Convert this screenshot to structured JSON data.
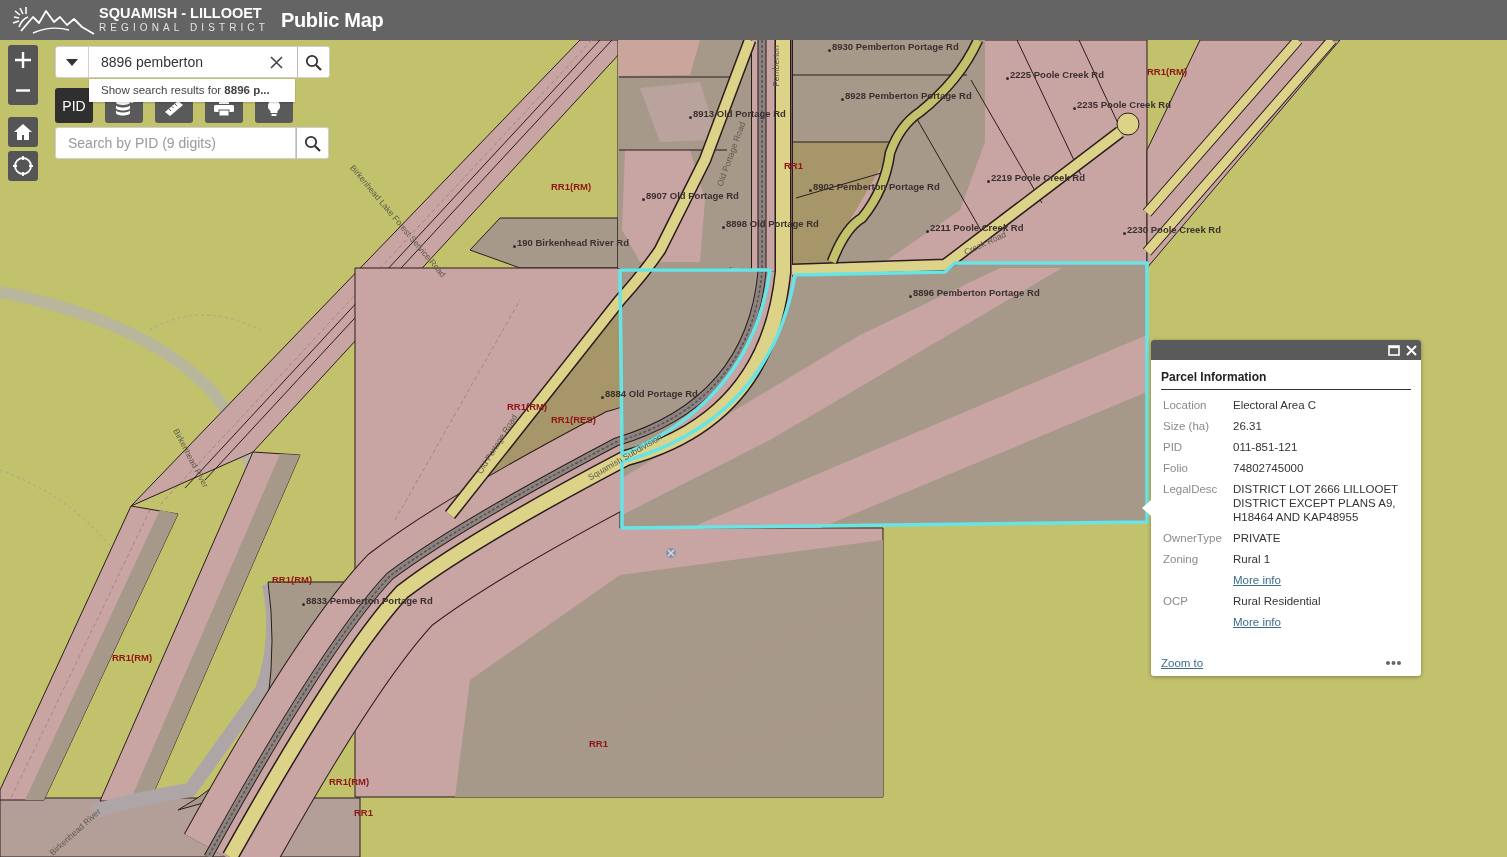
{
  "header": {
    "logo_line_1": "SQUAMISH - LILLOOET",
    "logo_line_2": "REGIONAL DISTRICT",
    "title": "Public Map"
  },
  "search": {
    "value": "8896 pemberton",
    "suggestion": "Show search results for **8896 p...**"
  },
  "toolbar": [
    {
      "kind": "text",
      "label": "PID",
      "selected": true
    },
    {
      "kind": "layers",
      "selected": false
    },
    {
      "kind": "measure",
      "selected": false
    },
    {
      "kind": "print",
      "selected": false
    },
    {
      "kind": "bulb",
      "selected": false
    }
  ],
  "pid_search": {
    "placeholder": "Search by PID (9 digits)"
  },
  "map": {
    "address_labels": [
      "8930 Pemberton Portage Rd",
      "2225 Poole Creek Rd",
      "8928 Pemberton Portage Rd",
      "2235 Poole Creek Rd",
      "8913 Old Portage Rd",
      "2219 Poole Creek Rd",
      "8902 Pemberton Portage Rd",
      "8907 Old Portage Rd",
      "8898 Old Portage Rd",
      "2211 Poole Creek Rd",
      "2230 Poole Creek Rd",
      "190 Birkenhead River Rd",
      "8896 Pemberton Portage Rd",
      "8884 Old Portage Rd",
      "8833 Pemberton Portage Rd"
    ],
    "zoning_labels": [
      "RR1(RM)",
      "RR1",
      "RR1(RM)",
      "RR1(RM)",
      "RR1(RES)",
      "RR1(RM)",
      "RR1(RM)",
      "RR1",
      "RR1(RM)",
      "RR1"
    ],
    "road_labels": [
      "Pemberton",
      "Old Portage Road",
      "Birkenhead Lake Forest Service Road",
      "Old Portage Road",
      "Squamish Subdivision",
      "Creek Road",
      "Birkenhead River",
      "Birkenhead River"
    ]
  },
  "popup": {
    "title": "Parcel Information",
    "rows": [
      {
        "label": "Location",
        "value": "Electoral Area C"
      },
      {
        "label": "Size (ha)",
        "value": "26.31"
      },
      {
        "label": "PID",
        "value": "011-851-121"
      },
      {
        "label": "Folio",
        "value": "74802745000"
      },
      {
        "label": "LegalDesc",
        "value": "DISTRICT LOT 2666 LILLOOET DISTRICT EXCEPT PLANS A9, H18464 AND KAP48955"
      },
      {
        "label": "OwnerType",
        "value": "PRIVATE"
      },
      {
        "label": "Zoning",
        "value": "Rural 1",
        "link": "More info"
      },
      {
        "label": "OCP",
        "value": "Rural Residential",
        "link": "More info"
      }
    ],
    "footer_link": "Zoom to"
  }
}
